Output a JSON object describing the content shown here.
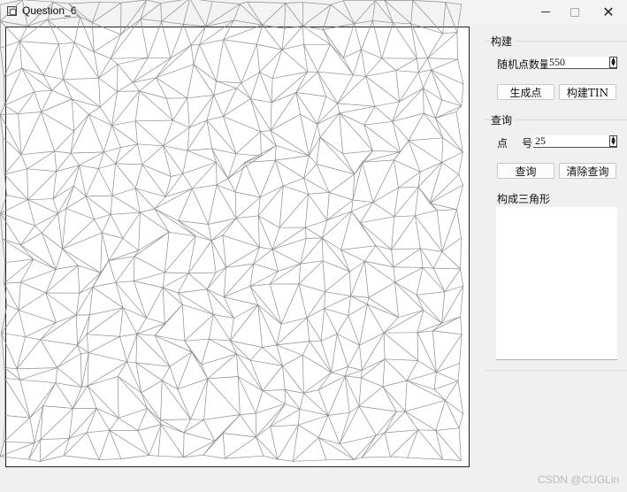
{
  "window": {
    "title": "Question_6",
    "minimize_icon": "minimize-icon",
    "maximize_icon": "maximize-icon",
    "close_icon": "close-icon"
  },
  "build_group": {
    "title": "构建",
    "point_count_label": "随机点数量",
    "point_count_value": "550",
    "generate_button": "生成点",
    "build_tin_button": "构建TIN"
  },
  "query_group": {
    "title": "查询",
    "point_label_1": "点",
    "point_label_2": "号",
    "point_id_value": "25",
    "query_button": "查询",
    "clear_button": "清除查询",
    "triangles_label": "构成三角形",
    "triangles_list": []
  },
  "watermark": "CSDN @CUGLin",
  "colors": {
    "window_bg": "#f0f0f0",
    "canvas_bg": "#ffffff",
    "tin_edge": "#8c8c8c"
  }
}
